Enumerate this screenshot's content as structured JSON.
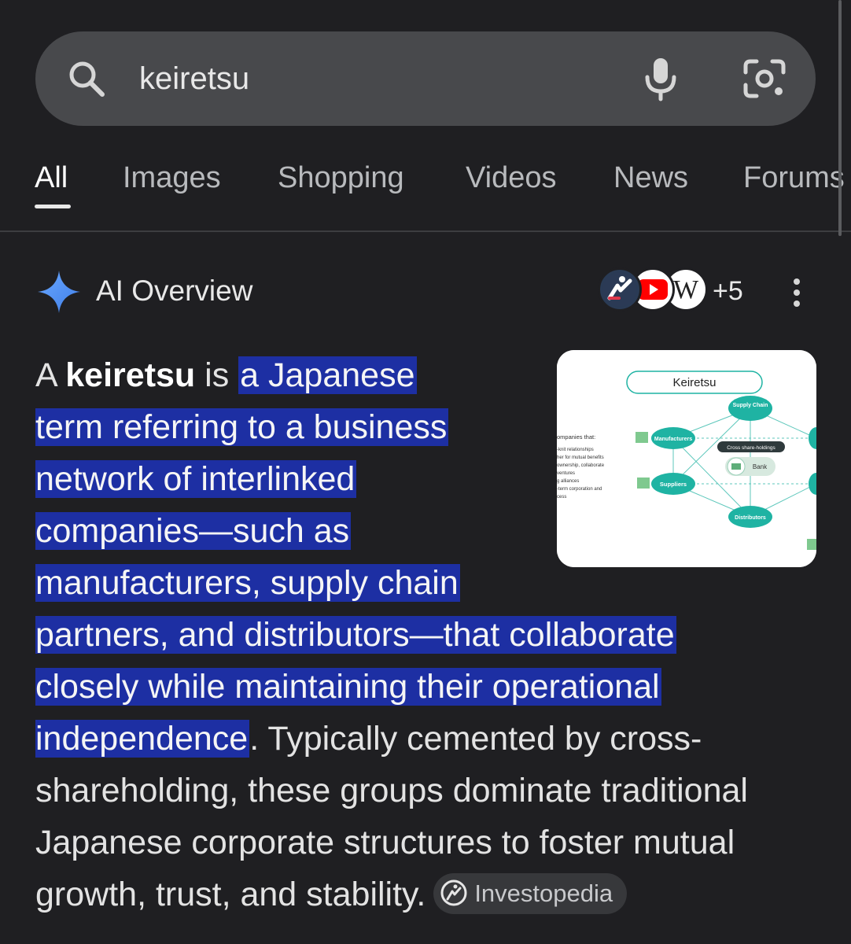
{
  "search": {
    "query": "keiretsu"
  },
  "tabs": [
    {
      "label": "All",
      "active": true
    },
    {
      "label": "Images"
    },
    {
      "label": "Shopping"
    },
    {
      "label": "Videos"
    },
    {
      "label": "News"
    },
    {
      "label": "Forums"
    }
  ],
  "ai_overview": {
    "title": "AI Overview",
    "source_icons": [
      "investopedia-icon",
      "youtube-icon",
      "wikipedia-icon"
    ],
    "wiki_letter": "W",
    "more_sources": "+5",
    "text": {
      "line1_prefix": "A ",
      "line1_bold": "keiretsu",
      "line1_mid": " is ",
      "line1_hl": "a Japanese",
      "line2_hl": "term referring to a business",
      "line3_hl": "network of interlinked",
      "line4_hl": "companies—such as",
      "line5_hl": "manufacturers, supply chain",
      "line6_hl": "partners, and distributors—that collaborate",
      "line7_hl": "closely while maintaining their operational",
      "line8_hl": "independence",
      "line8_rest": ". Typically cemented by cross-",
      "line9": "shareholding, these groups dominate traditional",
      "line10": "Japanese corporate structures to foster mutual",
      "line11": "growth, trust, and stability."
    },
    "citation": "Investopedia",
    "thumbnail": {
      "title": "Keiretsu",
      "nodes": [
        "Supply Chain",
        "Manufacturers",
        "Cross share-holdings",
        "Bank",
        "Suppliers",
        "Distributors"
      ],
      "side_text": [
        "ompanies that:",
        "-knit relationships",
        "her for mutual benefits",
        "ownership, collaborate",
        "ventures",
        "g alliances",
        "-term corporation and",
        "cess"
      ]
    }
  },
  "colors": {
    "background": "#1f1f22",
    "search_bar": "#48494c",
    "highlight": "#1d2fa3",
    "gemini_spark": "#4c8df6",
    "thumb_teal": "#1fb3a3"
  }
}
